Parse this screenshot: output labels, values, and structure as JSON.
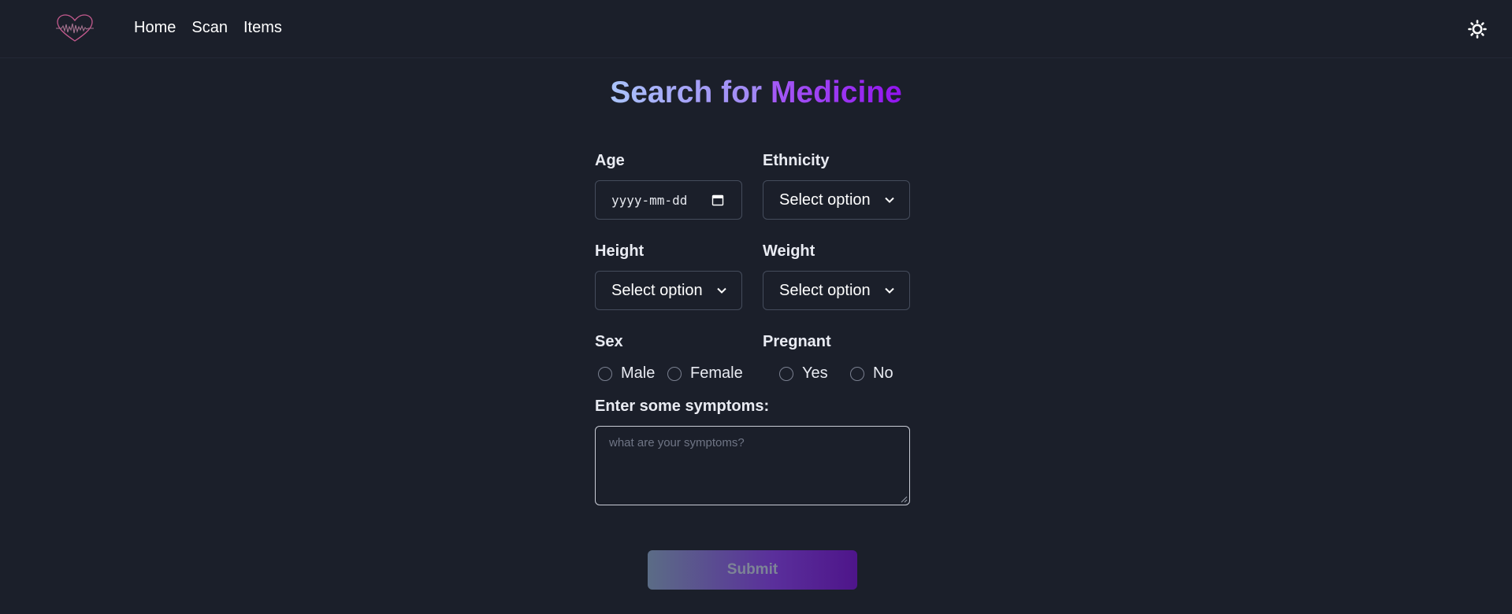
{
  "nav": {
    "links": [
      "Home",
      "Scan",
      "Items"
    ]
  },
  "page": {
    "title_part1": "Search for",
    "title_part2": "Medicine"
  },
  "form": {
    "age": {
      "label": "Age",
      "placeholder": "yyyy-mm-dd"
    },
    "ethnicity": {
      "label": "Ethnicity",
      "value": "Select option"
    },
    "height": {
      "label": "Height",
      "value": "Select option"
    },
    "weight": {
      "label": "Weight",
      "value": "Select option"
    },
    "sex": {
      "label": "Sex",
      "options": [
        "Male",
        "Female"
      ]
    },
    "pregnant": {
      "label": "Pregnant",
      "options": [
        "Yes",
        "No"
      ]
    },
    "symptoms": {
      "label": "Enter some symptoms:",
      "placeholder": "what are your symptoms?"
    },
    "submit_label": "Submit"
  },
  "colors": {
    "background": "#1b1f2a",
    "title_gradient_start": "#aac4fb",
    "title_gradient_end": "#9213ee",
    "logo": "#c45a8e"
  },
  "icons": {
    "logo": "heart-pulse-logo-icon",
    "theme": "sun-icon",
    "select": "chevron-down-icon",
    "date": "calendar-icon"
  }
}
